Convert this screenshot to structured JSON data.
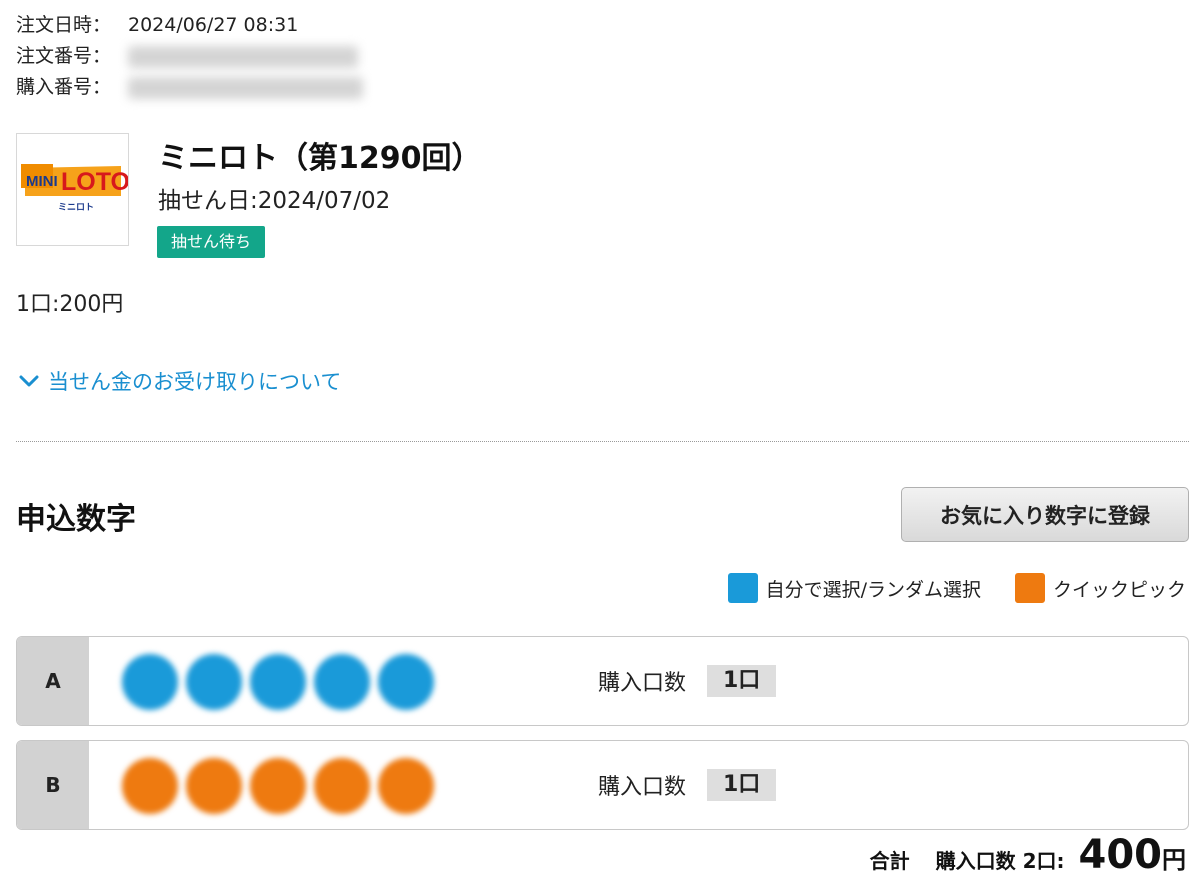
{
  "order": {
    "datetime_label": "注文日時：",
    "datetime_value": "2024/06/27 08:31",
    "order_no_label": "注文番号：",
    "purchase_no_label": "購入番号："
  },
  "product": {
    "logo_text_mini": "MINI",
    "logo_text_loto": "LOTO",
    "logo_subtext": "ミニロト",
    "title": "ミニロト（第1290回）",
    "draw_date": "抽せん日:2024/07/02",
    "status": "抽せん待ち",
    "unit_price": "1口:200円"
  },
  "prize_link": "当せん金のお受け取りについて",
  "numbers_section": {
    "title": "申込数字",
    "favorite_button": "お気に入り数字に登録",
    "legend_self": "自分で選択/ランダム選択",
    "legend_quick": "クイックピック",
    "qty_label": "購入口数",
    "rows": [
      {
        "label": "A",
        "qty": "1口"
      },
      {
        "label": "B",
        "qty": "1口"
      }
    ]
  },
  "total": {
    "label": "合計",
    "qty": "購入口数 2口:",
    "amount": "400",
    "unit": "円"
  },
  "colors": {
    "self_select": "#1a9ad9",
    "quick_pick": "#ee7a10",
    "status_badge": "#13a68a",
    "link": "#1a8fd0"
  },
  "icons": {
    "prize_link": "chevron-down-icon"
  }
}
